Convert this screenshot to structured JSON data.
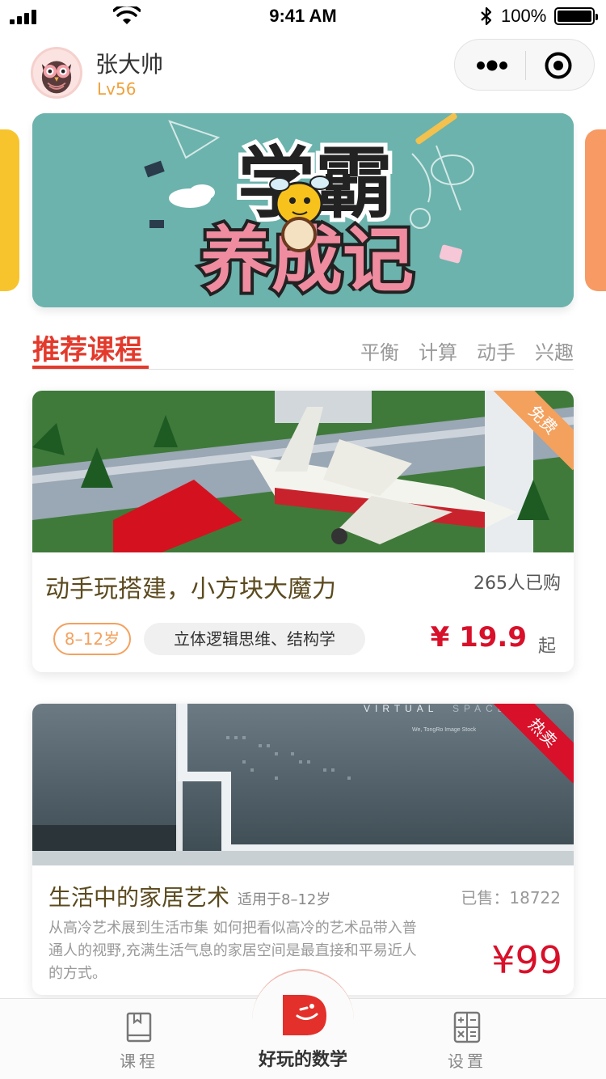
{
  "status_bar": {
    "time": "9:41 AM",
    "battery": "100%",
    "signal_icon": "signal-bars-icon",
    "wifi_icon": "wifi-icon",
    "bluetooth_icon": "bluetooth-icon"
  },
  "user": {
    "name": "张大帅",
    "level": "Lv56",
    "avatar_icon": "owl-avatar"
  },
  "capsule": {
    "more_icon": "more-dots-icon",
    "close_icon": "target-circle-icon"
  },
  "banner": {
    "title_line1": "学霸",
    "title_line2": "养成记",
    "bg_color": "#6cb3ad"
  },
  "section": {
    "title": "推荐课程",
    "tabs": [
      "平衡",
      "计算",
      "动手",
      "兴趣"
    ],
    "accent_color": "#e33a2c"
  },
  "courses": [
    {
      "badge": "免费",
      "title": "动手玩搭建，小方块大魔力",
      "sold": "265人已购",
      "age_tag": "8–12岁",
      "skill_tag": "立体逻辑思维、结构学",
      "price": "¥ 19.9",
      "price_suffix": "起",
      "image": "lego-airplane-photo"
    },
    {
      "badge": "热卖",
      "title": "生活中的家居艺术",
      "age": "适用于8–12岁",
      "sold": "已售：18722",
      "description": "从高冷艺术展到生活市集 如何把看似高冷的艺术品带入普通人的视野,充满生活气息的家居空间是最直接和平易近人的方式。",
      "price": "¥99",
      "image_text_1": "VIRTUAL",
      "image_text_2": "SPACE",
      "image_caption": "We, TongRo Image Stock"
    }
  ],
  "tabbar": {
    "courses_label": "课程",
    "center_label": "好玩的数学",
    "settings_label": "设置",
    "courses_icon": "book-icon",
    "center_icon": "app-logo-icon",
    "settings_icon": "calculator-icon",
    "price_color": "#d8102a"
  }
}
